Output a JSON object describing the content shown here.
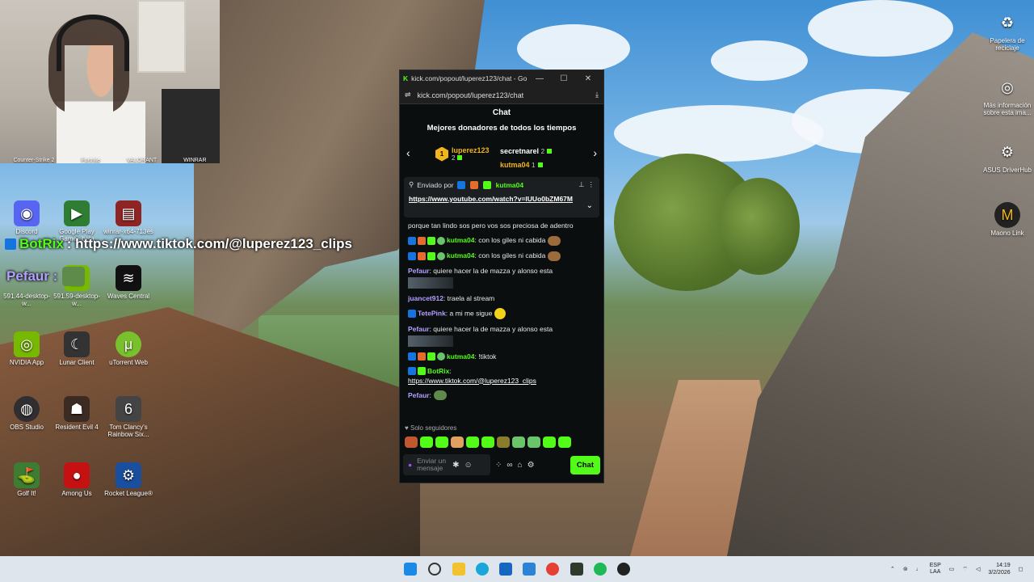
{
  "desktop_icons": [
    {
      "label": "Discord",
      "icon": "discord-icon",
      "color": "#5865f2"
    },
    {
      "label": "Google Play Games beta",
      "icon": "google-play-icon",
      "color": "#2e7d32"
    },
    {
      "label": "winrar-x64-713es",
      "icon": "winrar-icon",
      "color": "#8e2424"
    },
    {
      "label": "591.44-desktop-w...",
      "icon": "nvidia-driver-icon",
      "color": "#76b900"
    },
    {
      "label": "591.59-desktop-w...",
      "icon": "nvidia-driver-icon",
      "color": "#76b900"
    },
    {
      "label": "Waves Central",
      "icon": "waves-icon",
      "color": "#111111"
    },
    {
      "label": "NVIDIA App",
      "icon": "nvidia-icon",
      "color": "#76b900"
    },
    {
      "label": "Lunar Client",
      "icon": "lunar-icon",
      "color": "#333333"
    },
    {
      "label": "uTorrent Web",
      "icon": "utorrent-icon",
      "color": "#78c02c"
    },
    {
      "label": "OBS Studio",
      "icon": "obs-icon",
      "color": "#302e31"
    },
    {
      "label": "Resident Evil 4",
      "icon": "re4-icon",
      "color": "#3b2b22"
    },
    {
      "label": "Tom Clancy's Rainbow Six...",
      "icon": "r6-icon",
      "color": "#444444"
    },
    {
      "label": "Golf It!",
      "icon": "golf-icon",
      "color": "#3c7d32"
    },
    {
      "label": "Among Us",
      "icon": "among-us-icon",
      "color": "#c51111"
    },
    {
      "label": "Rocket League®",
      "icon": "rocket-league-icon",
      "color": "#1a4fa0"
    }
  ],
  "webcam_labels": [
    "Counter-Strike 2",
    "Fortnite",
    "VALORANT",
    "WINRAR"
  ],
  "right_icons": [
    {
      "label": "Papelera de reciclaje",
      "icon": "recycle-bin-icon"
    },
    {
      "label": "Más información sobre esta ima...",
      "icon": "info-camera-icon"
    },
    {
      "label": "ASUS DriverHub",
      "icon": "asus-icon"
    },
    {
      "label": "Maono Link",
      "icon": "maono-icon"
    }
  ],
  "overlay": {
    "botrix_name": "BotRix",
    "botrix_text": ": https://www.tiktok.com/@luperez123_clips",
    "pefaur_name": "Pefaur :"
  },
  "window": {
    "title": "kick.com/popout/luperez123/chat - Go...",
    "url": "kick.com/popout/luperez123/chat",
    "brand_color": "#53fc18"
  },
  "chat": {
    "header": "Chat",
    "donors_title": "Mejores donadores de todos los tiempos",
    "donors": [
      {
        "rank": "1",
        "name": "luperez123",
        "count": "2"
      },
      {
        "name": "secretnarel",
        "count": "2"
      },
      {
        "name": "kutma04",
        "count": "1"
      }
    ],
    "pinned": {
      "sent_by": "Enviado por",
      "user": "kutma04",
      "link": "https://www.youtube.com/watch?v=lUUo0bZM67M"
    },
    "partial_line": "porque tan lindo sos pero vos sos preciosa de adentro",
    "messages": [
      {
        "user": "kutma04",
        "color": "#53fc18",
        "text": ": con los giles ni cabida"
      },
      {
        "user": "kutma04",
        "color": "#53fc18",
        "text": ": con los giles ni cabida"
      },
      {
        "user": "Pefaur",
        "color": "#b3a0ff",
        "text": ": quiere hacer la de mazza y alonso esta"
      },
      {
        "user": "juancet912",
        "color": "#b3a0ff",
        "text": ": traela al stream"
      },
      {
        "user": "TetePink",
        "color": "#b3a0ff",
        "text": ": a mi me sigue"
      },
      {
        "user": "Pefaur",
        "color": "#b3a0ff",
        "text": ": quiere hacer la de mazza y alonso esta"
      },
      {
        "user": "kutma04",
        "color": "#53fc18",
        "text": ": !tiktok"
      },
      {
        "user": "BotRix",
        "color": "#53fc18",
        "text": ":",
        "link": "https://www.tiktok.com/@luperez123_clips"
      },
      {
        "user": "Pefaur",
        "color": "#b3a0ff",
        "text": ":"
      }
    ],
    "followers_only": "Solo seguidores",
    "input_placeholder": "Enviar un mensaje",
    "send_label": "Chat"
  },
  "tray": {
    "lang1": "ESP",
    "lang2": "LAA",
    "time": "14:19",
    "date": "3/2/2026"
  }
}
